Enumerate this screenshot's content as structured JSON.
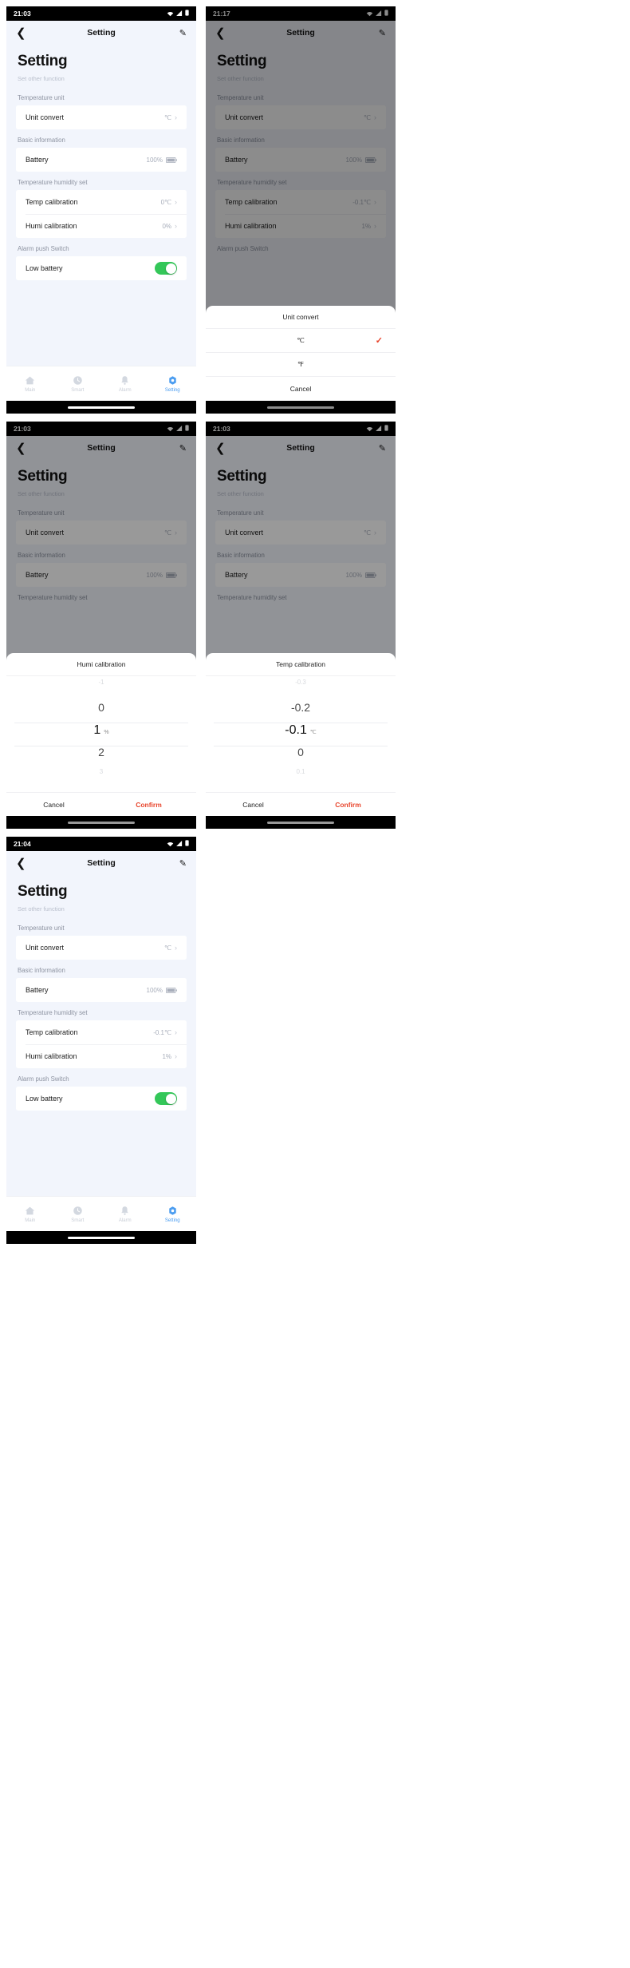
{
  "app": {
    "nav_title": "Setting",
    "page_title": "Setting",
    "page_subtitle": "Set other function",
    "back_icon": "chevron-left-icon",
    "edit_icon": "pencil-icon"
  },
  "sections": {
    "temperature_unit": "Temperature unit",
    "basic_information": "Basic information",
    "temperature_humidity_set": "Temperature humidity set",
    "alarm_push_switch": "Alarm push Switch"
  },
  "rows": {
    "unit_convert": "Unit convert",
    "battery": "Battery",
    "temp_calibration": "Temp calibration",
    "humi_calibration": "Humi calibration",
    "low_battery": "Low battery"
  },
  "values": {
    "unit_celsius": "℃",
    "battery_level": "100%",
    "temp_cal_zero": "0℃",
    "humi_cal_zero": "0%",
    "temp_cal_minus": "-0.1℃",
    "humi_cal_one": "1%",
    "chevron": "›"
  },
  "tabs": [
    {
      "label": "Main",
      "icon": "home-icon"
    },
    {
      "label": "Smart",
      "icon": "clock-icon"
    },
    {
      "label": "Alarm",
      "icon": "bell-icon"
    },
    {
      "label": "Setting",
      "icon": "gear-icon"
    }
  ],
  "unit_sheet": {
    "title": "Unit convert",
    "options": [
      "℃",
      "℉"
    ],
    "selected": "℃",
    "cancel": "Cancel",
    "check_icon": "check-icon"
  },
  "humi_picker": {
    "title": "Humi calibration",
    "unit": "%",
    "items": [
      "-1",
      "0",
      "1",
      "2",
      "3"
    ],
    "selected": "1",
    "cancel": "Cancel",
    "confirm": "Confirm"
  },
  "temp_picker": {
    "title": "Temp calibration",
    "unit": "℃",
    "items": [
      "-0.3",
      "-0.2",
      "-0.1",
      "0",
      "0.1"
    ],
    "selected": "-0.1",
    "cancel": "Cancel",
    "confirm": "Confirm"
  },
  "statusbar": {
    "time_1": "21:03",
    "time_2": "21:17",
    "time_3": "21:03",
    "time_4": "21:03",
    "time_5": "21:04",
    "wifi_icon": "wifi-icon",
    "signal_icon": "signal-icon",
    "battery_icon": "battery-icon"
  },
  "colors": {
    "accent_blue": "#4c9df0",
    "toggle_green": "#34c759",
    "confirm_red": "#e8452c",
    "page_bg": "#f2f5fc"
  }
}
